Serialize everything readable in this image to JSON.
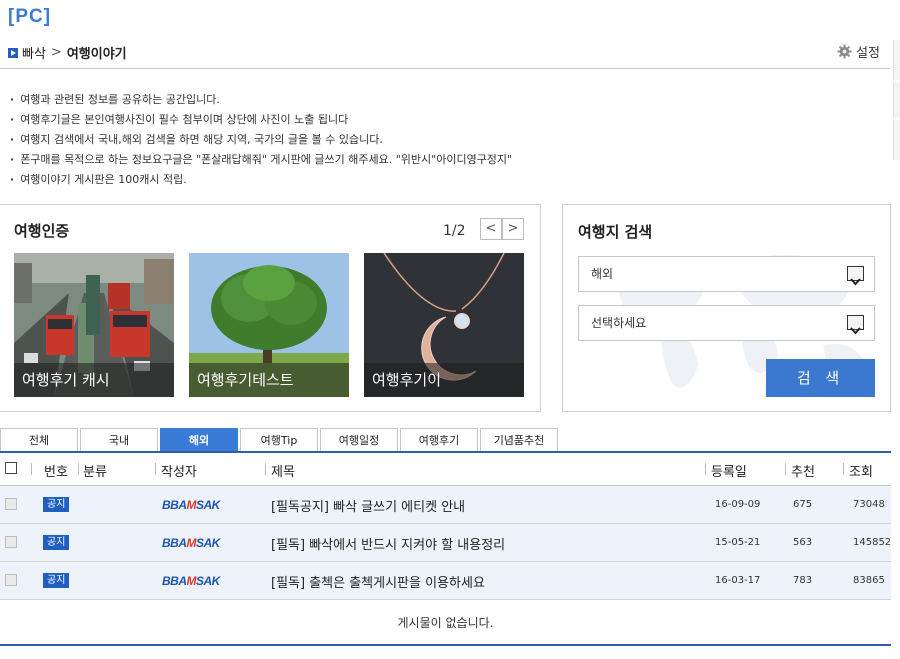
{
  "header": {
    "pc_label": "[PC]",
    "breadcrumb_root": "빠삭",
    "breadcrumb_sep": ">",
    "breadcrumb_current": "여행이야기",
    "settings_label": "설정"
  },
  "notices": [
    "여행과 관련된 정보를 공유하는 공간입니다.",
    "여행후기글은 본인여행사진이 필수 첨부이며 상단에 사진이 노출 됩니다",
    "여행지 검색에서 국내,해외 검색을 하면 해당 지역, 국가의 글을 볼 수 있습니다.",
    "폰구매를 목적으로 하는 정보요구글은 \"폰살래답해줘\" 게시판에 글쓰기 해주세요. \"위반시\"아이디영구정지\"",
    "여행이야기 게시판은 100캐시 적립."
  ],
  "auth": {
    "title": "여행인증",
    "page": "1/2",
    "prev": "<",
    "next": ">",
    "cards": [
      "여행후기 캐시",
      "여행후기테스트",
      "여행후기이"
    ]
  },
  "search": {
    "title": "여행지 검색",
    "region_value": "해외",
    "country_value": "선택하세요",
    "button": "검 색"
  },
  "tabs": [
    "전체",
    "국내",
    "해외",
    "여행Tip",
    "여행일정",
    "여행후기",
    "기념품추천"
  ],
  "active_tab": "해외",
  "table": {
    "headers": {
      "no": "번호",
      "category": "분류",
      "author": "작성자",
      "title": "제목",
      "date": "등록일",
      "recommend": "추천",
      "views": "조회"
    },
    "rows": [
      {
        "badge": "공지",
        "author_logo": "BBASAK",
        "title": "[필독공지] 빠삭 글쓰기 에티켓 안내",
        "date": "16-09-09",
        "recommend": "675",
        "views": "73048"
      },
      {
        "badge": "공지",
        "author_logo": "BBASAK",
        "title": "[필독] 빠삭에서 반드시 지켜야 할 내용정리",
        "date": "15-05-21",
        "recommend": "563",
        "views": "145852"
      },
      {
        "badge": "공지",
        "author_logo": "BBASAK",
        "title": "[필독] 출첵은 출첵게시판을 이용하세요",
        "date": "16-03-17",
        "recommend": "783",
        "views": "83865"
      }
    ],
    "empty_message": "게시물이 없습니다."
  },
  "colors": {
    "accent": "#3a7bd5",
    "brand_blue": "#1d56b0",
    "brand_red": "#e03a2b",
    "row_bg": "#eef3fb"
  }
}
